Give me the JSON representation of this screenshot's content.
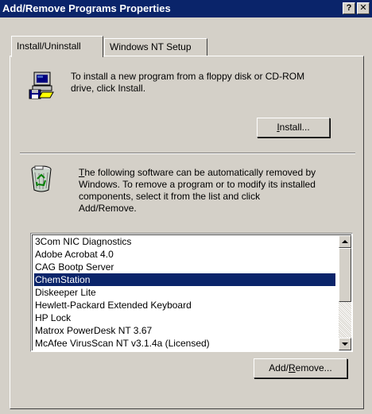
{
  "window": {
    "title": "Add/Remove Programs Properties",
    "help_button": "?",
    "close_button": "✕"
  },
  "tabs": [
    {
      "label": "Install/Uninstall",
      "active": true
    },
    {
      "label": "Windows NT Setup",
      "active": false
    }
  ],
  "install": {
    "description_line1": "To install a new program from a floppy disk or CD-ROM",
    "description_line2": "drive, click Install.",
    "button_mnemonic": "I",
    "button_rest": "nstall..."
  },
  "uninstall": {
    "description_mnemonic": "T",
    "description_line1_rest": "he following software can be automatically removed by",
    "description_line2": "Windows. To remove a program or to modify its installed",
    "description_line3": "components, select it from the list and click",
    "description_line4": "Add/Remove.",
    "programs": [
      "3Com NIC Diagnostics",
      "Adobe Acrobat 4.0",
      "CAG Bootp Server",
      "ChemStation",
      "Diskeeper Lite",
      "Hewlett-Packard Extended Keyboard",
      "HP Lock",
      "Matrox PowerDesk NT 3.67",
      "McAfee VirusScan NT v3.1.4a (Licensed)"
    ],
    "selected_index": 3,
    "button_prefix": "Add/",
    "button_mnemonic": "R",
    "button_rest": "emove..."
  },
  "colors": {
    "titlebar": "#0a246a",
    "selection": "#0a246a",
    "face": "#d4d0c8"
  }
}
